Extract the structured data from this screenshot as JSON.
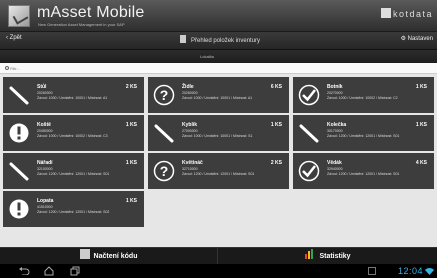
{
  "app": {
    "title": "mAsset Mobile",
    "subtitle": "New Generation Asset Management in your SAP",
    "brand": "kotdata"
  },
  "toolbar": {
    "back": "‹ Zpět",
    "page_title": "Přehled položek inventury",
    "settings": "⚙ Nastaven"
  },
  "location_header": "Lokalita",
  "filter": {
    "placeholder": "Filtr..."
  },
  "items": [
    {
      "status": "ok-partial",
      "name": "Stůl",
      "qty": "2 KS",
      "code": "20260000",
      "loc": "Závod: 1000 / Umístění: 10001 / Místnost: A1"
    },
    {
      "status": "unknown",
      "name": "Židle",
      "qty": "6 KS",
      "code": "20260000",
      "loc": "Závod: 1000 / Umístění: 10001 / Místnost: A1"
    },
    {
      "status": "done",
      "name": "Botník",
      "qty": "1 KS",
      "code": "20270000",
      "loc": "Závod: 1000 / Umístění: 10002 / Místnost: C2"
    },
    {
      "status": "alert",
      "name": "Koště",
      "qty": "1 KS",
      "code": "20450000",
      "loc": "Závod: 1000 / Umístění: 10002 / Místnost: C3"
    },
    {
      "status": "ok-partial",
      "name": "Kyblík",
      "qty": "1 KS",
      "code": "27000000",
      "loc": "Závod: 1000 / Umístění: 10001 / Místnost: S1"
    },
    {
      "status": "ok-partial",
      "name": "Kolečka",
      "qty": "1 KS",
      "code": "30170000",
      "loc": "Závod: 1200 / Umístění: 12001 / Místnost: S01"
    },
    {
      "status": "ok-partial",
      "name": "Nářadí",
      "qty": "1 KS",
      "code": "32100000",
      "loc": "Závod: 1200 / Umístění: 12001 / Místnost: S01"
    },
    {
      "status": "unknown",
      "name": "Květináč",
      "qty": "2 KS",
      "code": "32710000",
      "loc": "Závod: 1200 / Umístění: 12001 / Místnost: S01"
    },
    {
      "status": "done",
      "name": "Vědák",
      "qty": "4 KS",
      "code": "32940000",
      "loc": "Závod: 1200 / Umístění: 12001 / Místnost: S01"
    },
    {
      "status": "alert",
      "name": "Lopata",
      "qty": "1 KS",
      "code": "41510000",
      "loc": "Závod: 1200 / Umístění: 12001 / Místnost: S02"
    }
  ],
  "bottom": {
    "scan": "Načtení kódu",
    "stats": "Statistiky"
  },
  "system": {
    "time": "12:04"
  },
  "icons": [
    "logo-icon",
    "back-icon",
    "document-icon",
    "gear-icon",
    "search-icon",
    "qr-code-icon",
    "bar-chart-icon",
    "back-nav-icon",
    "home-icon",
    "recent-apps-icon",
    "wifi-icon"
  ]
}
